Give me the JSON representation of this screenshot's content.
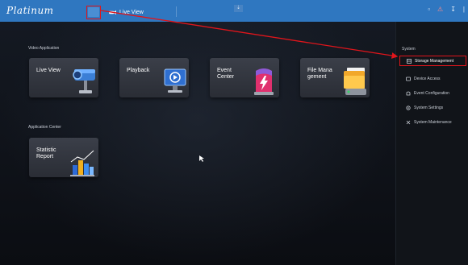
{
  "topbar": {
    "logo": "Platinum",
    "tab_label": "Live View",
    "download_glyph": "⇣",
    "icons": [
      "notification-icon",
      "alarm-icon",
      "download-icon",
      "more-icon"
    ]
  },
  "main": {
    "video_section": "Video Application",
    "app_section": "Application Center",
    "tiles": [
      {
        "label": "Live View",
        "icon": "camera-icon"
      },
      {
        "label": "Playback",
        "icon": "playback-monitor-icon"
      },
      {
        "label": "Event Center",
        "label_lines": [
          "Event",
          "Center"
        ],
        "icon": "event-light-icon"
      },
      {
        "label": "File Management",
        "label_lines": [
          "File Mana",
          "gement"
        ],
        "icon": "folder-hdd-icon"
      },
      {
        "label": "Statistic Report",
        "label_lines": [
          "Statistic",
          "Report"
        ],
        "icon": "bar-chart-icon"
      }
    ]
  },
  "sidebar": {
    "title": "System",
    "items": [
      {
        "label": "Storage Management",
        "icon": "storage-icon",
        "highlighted": true
      },
      {
        "label": "Device Access",
        "icon": "device-icon"
      },
      {
        "label": "Event Configuration",
        "icon": "event-config-icon"
      },
      {
        "label": "System Settings",
        "icon": "settings-gear-icon"
      },
      {
        "label": "System Maintenance",
        "icon": "maintenance-icon"
      }
    ]
  },
  "colors": {
    "topbar": "#2f77c0",
    "annotation": "#e0151b",
    "background": "#0d1016"
  }
}
